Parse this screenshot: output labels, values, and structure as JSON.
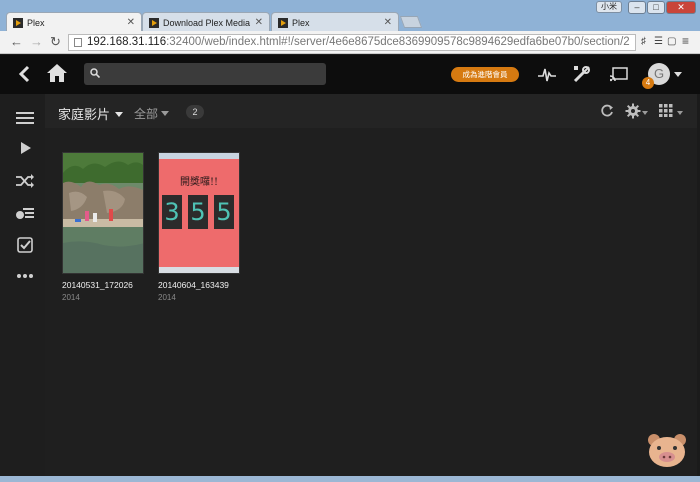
{
  "browser": {
    "tabs": [
      {
        "title": "Plex",
        "active": true
      },
      {
        "title": "Download Plex Media Se",
        "active": false
      },
      {
        "title": "Plex",
        "active": false
      }
    ],
    "user_label": "小米",
    "window_controls": {
      "minimize": "–",
      "maximize": "□",
      "close": "✕"
    },
    "url_host": "192.168.31.116",
    "url_rest": ":32400/web/index.html#!/server/4e6e8675dce8369909578c9894629edfa6be07b0/section/2"
  },
  "plex": {
    "premium_label": "成為進階會員",
    "avatar_letter": "G",
    "notification_count": "4",
    "library_title": "家庭影片",
    "filter_label": "全部",
    "item_count": "2",
    "items": [
      {
        "title": "20140531_172026",
        "year": "2014"
      },
      {
        "title": "20140604_163439",
        "year": "2014"
      }
    ],
    "poster2_sign_text": "開獎囉!!",
    "poster2_digits": [
      "3",
      "5",
      "5"
    ]
  },
  "colors": {
    "accent": "#d67a11",
    "background": "#1f1f1f",
    "topbar": "#0d0d0d"
  },
  "icons": [
    "back-icon",
    "home-icon",
    "search-icon",
    "activity-icon",
    "tools-icon",
    "cast-icon",
    "menu-icon",
    "play-icon",
    "shuffle-icon",
    "playlist-icon",
    "checklist-icon",
    "more-icon",
    "refresh-icon",
    "gear-icon",
    "grid-icon"
  ]
}
